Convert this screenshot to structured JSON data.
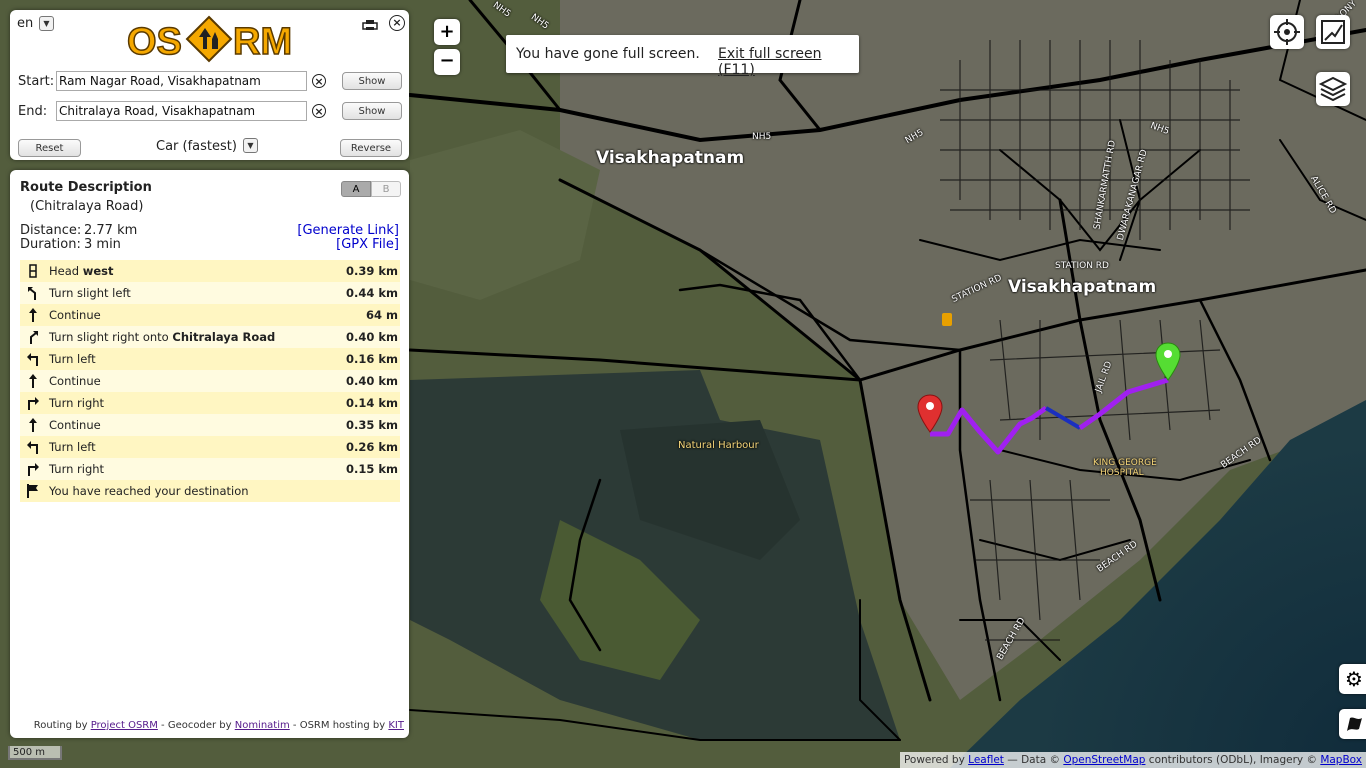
{
  "language": "en",
  "logo": "OSRM",
  "start": {
    "label": "Start:",
    "value": "Ram Nagar Road, Visakhapatnam",
    "show": "Show"
  },
  "end": {
    "label": "End:",
    "value": "Chitralaya Road, Visakhapatnam",
    "show": "Show"
  },
  "controls": {
    "reset": "Reset",
    "mode": "Car (fastest)",
    "reverse": "Reverse"
  },
  "route": {
    "title": "Route Description",
    "subtitle": "(Chitralaya Road)",
    "tab_a": "A",
    "tab_b": "B",
    "distance_label": "Distance:",
    "distance": "2.77 km",
    "duration_label": "Duration:",
    "duration": "3 min",
    "generate_link": "[Generate Link]",
    "gpx_file": "[GPX File]"
  },
  "instructions": [
    {
      "text": "Head ",
      "bold": "west",
      "dist": "0.39 km",
      "icon": "head-icon"
    },
    {
      "text": "Turn slight left",
      "bold": "",
      "dist": "0.44 km",
      "icon": "slight-left-icon"
    },
    {
      "text": "Continue",
      "bold": "",
      "dist": "64 m",
      "icon": "straight-icon"
    },
    {
      "text": "Turn slight right onto ",
      "bold": "Chitralaya Road",
      "dist": "0.40 km",
      "icon": "slight-right-icon"
    },
    {
      "text": "Turn left",
      "bold": "",
      "dist": "0.16 km",
      "icon": "turn-left-icon"
    },
    {
      "text": "Continue",
      "bold": "",
      "dist": "0.40 km",
      "icon": "straight-icon"
    },
    {
      "text": "Turn right",
      "bold": "",
      "dist": "0.14 km",
      "icon": "turn-right-icon"
    },
    {
      "text": "Continue",
      "bold": "",
      "dist": "0.35 km",
      "icon": "straight-icon"
    },
    {
      "text": "Turn left",
      "bold": "",
      "dist": "0.26 km",
      "icon": "turn-left-icon"
    },
    {
      "text": "Turn right",
      "bold": "",
      "dist": "0.15 km",
      "icon": "turn-right-icon"
    },
    {
      "text": "You have reached your destination",
      "bold": "",
      "dist": "",
      "icon": "flag-icon"
    }
  ],
  "footer": {
    "routing": "Routing by ",
    "project_osrm": "Project OSRM",
    "geocoder": " - Geocoder by ",
    "nominatim": "Nominatim",
    "hosting": " - OSRM hosting by ",
    "kit": "KIT"
  },
  "fullscreen": {
    "message": "You have gone full screen.",
    "exit": "Exit full screen (F11)"
  },
  "zoom": {
    "in": "+",
    "out": "−"
  },
  "scale": "500 m",
  "attribution": {
    "powered": "Powered by ",
    "leaflet": "Leaflet",
    "data": " — Data © ",
    "osm": "OpenStreetMap",
    "contrib": " contributors (ODbL), Imagery © ",
    "mapbox": "MapBox"
  },
  "map_labels": {
    "city1": "Visakhapatnam",
    "city2": "Visakhapatnam",
    "harbour": "Natural Harbour",
    "hospital1": "KING GEORGE",
    "hospital2": "HOSPITAL",
    "nh5_a": "NH5",
    "nh5_b": "NH5",
    "nh5_c": "NH5",
    "nh5_d": "NH5",
    "nh5_e": "NH5",
    "station_rd1": "STATION RD",
    "station_rd2": "STATION RD",
    "beach_rd1": "BEACH RD",
    "beach_rd2": "BEACH RD",
    "beach_rd3": "BEACH RD",
    "shankar": "SHANKARMATTH RD",
    "dwaraka": "DWARAKANAGAR RD",
    "alice": "ALICE RD",
    "jail": "JAIL RD",
    "hbcolony": "HB COLONY"
  },
  "colors": {
    "route": "#a020f0",
    "route_alt": "#1a2fbf",
    "start_marker": "#55dd33",
    "end_marker": "#e03030",
    "link": "#0000cc"
  }
}
